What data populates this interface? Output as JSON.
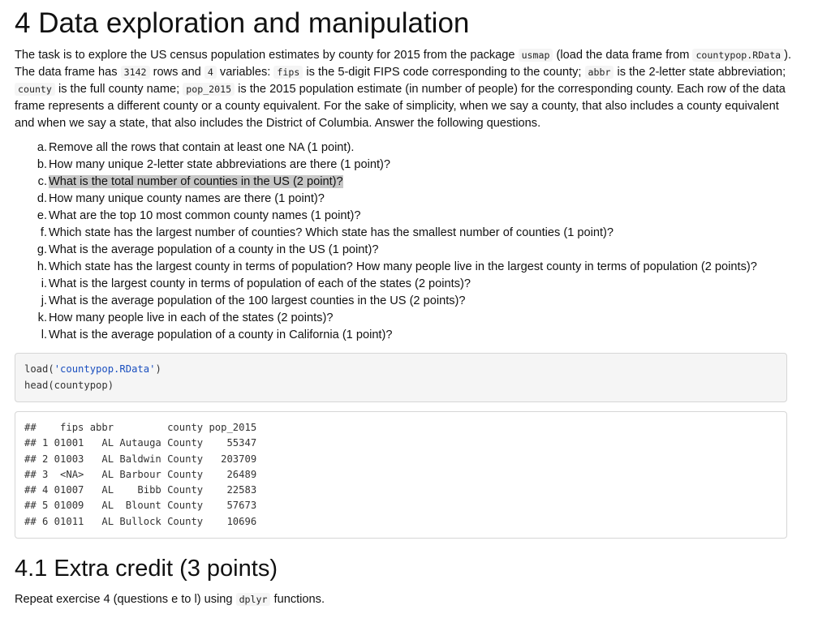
{
  "section": {
    "title": "4 Data exploration and manipulation"
  },
  "intro": {
    "t1": "The task is to explore the US census population estimates by county for 2015 from the package ",
    "c_usmap": "usmap",
    "t2": " (load the data frame from ",
    "c_file": "countypop.RData",
    "t3": "). The data frame has ",
    "c_rows": "3142",
    "t4": " rows and ",
    "c_vars": "4",
    "t5": " variables: ",
    "c_fips": "fips",
    "t6": " is the 5-digit FIPS code corresponding to the county; ",
    "c_abbr": "abbr",
    "t7": " is the 2-letter state abbreviation; ",
    "c_county": "county",
    "t8": " is the full county name; ",
    "c_pop": "pop_2015",
    "t9": " is the 2015 population estimate (in number of people) for the corresponding county. Each row of the data frame represents a different county or a county equivalent. For the sake of simplicity, when we say a county, that also includes a county equivalent and when we say a state, that also includes the District of Columbia. Answer the following questions."
  },
  "questions": [
    {
      "marker": "a.",
      "text": "Remove all the rows that contain at least one NA (1 point)."
    },
    {
      "marker": "b.",
      "text": "How many unique 2-letter state abbreviations are there (1 point)?"
    },
    {
      "marker": "c.",
      "text": "What is the total number of counties in the US (2 point)?"
    },
    {
      "marker": "d.",
      "text": "How many unique county names are there (1 point)?"
    },
    {
      "marker": "e.",
      "text": "What are the top 10 most common county names (1 point)?"
    },
    {
      "marker": "f.",
      "text": "Which state has the largest number of counties? Which state has the smallest number of counties (1 point)?"
    },
    {
      "marker": "g.",
      "text": "What is the average population of a county in the US (1 point)?"
    },
    {
      "marker": "h.",
      "text": "Which state has the largest county in terms of population? How many people live in the largest county in terms of population (2 points)?"
    },
    {
      "marker": "i.",
      "text": "What is the largest county in terms of population of each of the states (2 points)?"
    },
    {
      "marker": "j.",
      "text": "What is the average population of the 100 largest counties in the US (2 points)?"
    },
    {
      "marker": "k.",
      "text": "How many people live in each of the states (2 points)?"
    },
    {
      "marker": "l.",
      "text": "What is the average population of a county in California (1 point)?"
    }
  ],
  "code": {
    "l1_fn": "load(",
    "l1_str": "'countypop.RData'",
    "l1_end": ")",
    "l2": "head(countypop)"
  },
  "output": [
    "##    fips abbr         county pop_2015",
    "## 1 01001   AL Autauga County    55347",
    "## 2 01003   AL Baldwin County   203709",
    "## 3  <NA>   AL Barbour County    26489",
    "## 4 01007   AL    Bibb County    22583",
    "## 5 01009   AL  Blount County    57673",
    "## 6 01011   AL Bullock County    10696"
  ],
  "extra": {
    "title": "4.1 Extra credit (3 points)",
    "t1": "Repeat exercise 4 (questions e to l) using ",
    "c_dplyr": "dplyr",
    "t2": " functions."
  }
}
